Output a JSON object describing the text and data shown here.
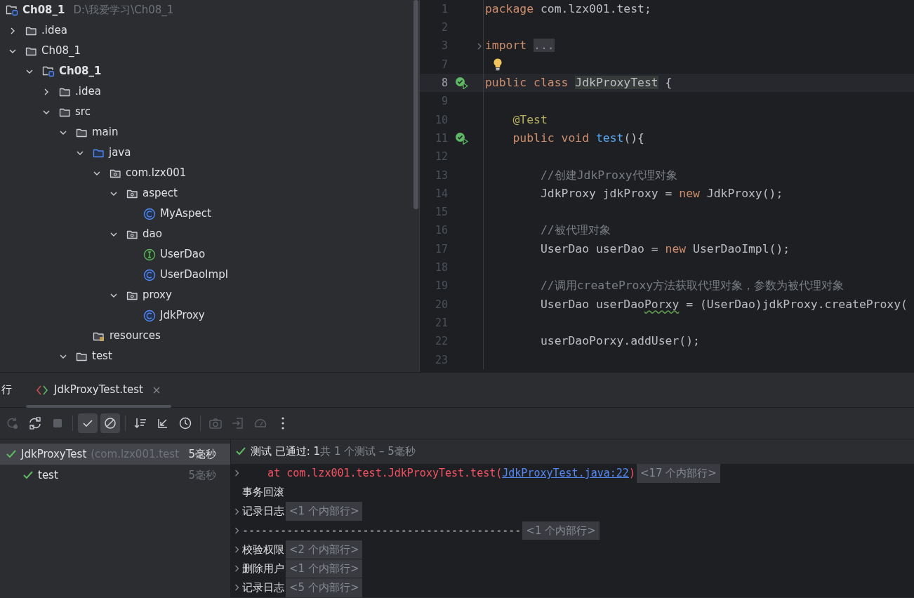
{
  "project": {
    "root": {
      "name": "Ch08_1",
      "path": "D:\\我爱学习\\Ch08_1"
    },
    "items": [
      {
        "name": ".idea",
        "kind": "folder",
        "expanded": false
      },
      {
        "name": "Ch08_1",
        "kind": "folder",
        "expanded": true,
        "children": [
          {
            "name": "Ch08_1",
            "kind": "module",
            "expanded": true,
            "children": [
              {
                "name": ".idea",
                "kind": "folder",
                "expanded": false
              },
              {
                "name": "src",
                "kind": "folder",
                "expanded": true,
                "children": [
                  {
                    "name": "main",
                    "kind": "folder",
                    "expanded": true,
                    "children": [
                      {
                        "name": "java",
                        "kind": "source",
                        "expanded": true,
                        "children": [
                          {
                            "name": "com.lzx001",
                            "kind": "package",
                            "expanded": true,
                            "children": [
                              {
                                "name": "aspect",
                                "kind": "package",
                                "expanded": true,
                                "children": [
                                  {
                                    "name": "MyAspect",
                                    "kind": "class"
                                  }
                                ]
                              },
                              {
                                "name": "dao",
                                "kind": "package",
                                "expanded": true,
                                "children": [
                                  {
                                    "name": "UserDao",
                                    "kind": "interface"
                                  },
                                  {
                                    "name": "UserDaoImpl",
                                    "kind": "class"
                                  }
                                ]
                              },
                              {
                                "name": "proxy",
                                "kind": "package",
                                "expanded": true,
                                "children": [
                                  {
                                    "name": "JdkProxy",
                                    "kind": "class"
                                  }
                                ]
                              }
                            ]
                          }
                        ]
                      },
                      {
                        "name": "resources",
                        "kind": "resources"
                      }
                    ]
                  },
                  {
                    "name": "test",
                    "kind": "folder",
                    "expanded": true
                  }
                ]
              }
            ]
          }
        ]
      }
    ]
  },
  "editor": {
    "lines": [
      {
        "number": "1",
        "tokens": [
          {
            "kind": "kw",
            "text": "package"
          },
          {
            "kind": "plain",
            "text": " com.lzx001.test;"
          }
        ]
      },
      {
        "number": "2"
      },
      {
        "number": "3",
        "foldable": true,
        "tokens": [
          {
            "kind": "kw",
            "text": "import "
          },
          {
            "kind": "folded",
            "text": "..."
          }
        ]
      },
      {
        "number": "7",
        "intention": true
      },
      {
        "number": "8",
        "run": true,
        "current": true,
        "tokens": [
          {
            "kind": "kw",
            "text": "public class "
          },
          {
            "kind": "highlight",
            "text": "JdkProxyTest"
          },
          {
            "kind": "plain",
            "text": " {"
          }
        ]
      },
      {
        "number": "9"
      },
      {
        "number": "10",
        "tokens": [
          {
            "kind": "anno",
            "text": "    @Test"
          }
        ]
      },
      {
        "number": "11",
        "run": true,
        "tokens": [
          {
            "kind": "kw",
            "text": "    public void "
          },
          {
            "kind": "fn",
            "text": "test"
          },
          {
            "kind": "plain",
            "text": "(){"
          }
        ]
      },
      {
        "number": "12"
      },
      {
        "number": "13",
        "tokens": [
          {
            "kind": "comment",
            "text": "        //创建JdkProxy代理对象"
          }
        ]
      },
      {
        "number": "14",
        "tokens": [
          {
            "kind": "plain",
            "text": "        JdkProxy jdkProxy = "
          },
          {
            "kind": "kw",
            "text": "new"
          },
          {
            "kind": "plain",
            "text": " JdkProxy();"
          }
        ]
      },
      {
        "number": "15"
      },
      {
        "number": "16",
        "tokens": [
          {
            "kind": "comment",
            "text": "        //被代理对象"
          }
        ]
      },
      {
        "number": "17",
        "tokens": [
          {
            "kind": "plain",
            "text": "        UserDao userDao = "
          },
          {
            "kind": "kw",
            "text": "new"
          },
          {
            "kind": "plain",
            "text": " UserDaoImpl();"
          }
        ]
      },
      {
        "number": "18"
      },
      {
        "number": "19",
        "tokens": [
          {
            "kind": "comment",
            "text": "        //调用createProxy方法获取代理对象，参数为被代理对象"
          }
        ]
      },
      {
        "number": "20",
        "tokens": [
          {
            "kind": "plain",
            "text": "        UserDao userDao"
          },
          {
            "kind": "typo",
            "text": "Porxy"
          },
          {
            "kind": "plain",
            "text": " = (UserDao)jdkProxy.createProxy("
          }
        ]
      },
      {
        "number": "21"
      },
      {
        "number": "22",
        "tokens": [
          {
            "kind": "plain",
            "text": "        userDaoPorxy.addUser();"
          }
        ]
      },
      {
        "number": "23"
      }
    ]
  },
  "run_panel": {
    "title": "行",
    "tabs": [
      {
        "label": "JdkProxyTest.test",
        "selected": true
      }
    ],
    "toolbar": [
      {
        "kind": "rerun",
        "disabled": true,
        "on": false
      },
      {
        "kind": "rerun-failed",
        "disabled": false,
        "on": false
      },
      {
        "kind": "stop",
        "disabled": true,
        "on": false
      },
      {
        "kind": "sep"
      },
      {
        "kind": "show-passed",
        "disabled": false,
        "on": true
      },
      {
        "kind": "show-ignored",
        "disabled": false,
        "on": true
      },
      {
        "kind": "sep"
      },
      {
        "kind": "sort",
        "disabled": false,
        "on": false
      },
      {
        "kind": "collapse",
        "disabled": false,
        "on": false
      },
      {
        "kind": "history",
        "disabled": false,
        "on": false
      },
      {
        "kind": "sep"
      },
      {
        "kind": "camera",
        "disabled": true,
        "on": false
      },
      {
        "kind": "export",
        "disabled": true,
        "on": false
      },
      {
        "kind": "gauge",
        "disabled": true,
        "on": false
      },
      {
        "kind": "more",
        "disabled": false,
        "on": false
      }
    ],
    "tests": [
      {
        "name": "JdkProxyTest",
        "package": "(com.lzx001.test",
        "duration": "5毫秒",
        "selected": true,
        "children": [
          {
            "name": "test",
            "duration": "5毫秒",
            "selected": false
          }
        ]
      }
    ],
    "status": {
      "label": "测试 已通过: 1",
      "summary": "共 1 个测试 – 5毫秒"
    },
    "console": [
      {
        "kind": "stack",
        "collapsible": true,
        "text": "    at com.lzx001.test.JdkProxyTest.test(",
        "link": "JdkProxyTest.java:22",
        "after": ")",
        "fold_label": "<17 个内部行>"
      },
      {
        "kind": "text",
        "collapsible": false,
        "text": "事务回滚"
      },
      {
        "kind": "text",
        "collapsible": true,
        "text": "记录日志",
        "fold_label": "<1 个内部行>"
      },
      {
        "kind": "mono",
        "collapsible": true,
        "text": "--------------------------------------------",
        "fold_label": "<1 个内部行>"
      },
      {
        "kind": "text",
        "collapsible": true,
        "text": "校验权限",
        "fold_label": "<2 个内部行>"
      },
      {
        "kind": "text",
        "collapsible": true,
        "text": "删除用户",
        "fold_label": "<1 个内部行>"
      },
      {
        "kind": "text",
        "collapsible": true,
        "text": "记录日志",
        "fold_label": "<5 个内部行>"
      }
    ]
  }
}
